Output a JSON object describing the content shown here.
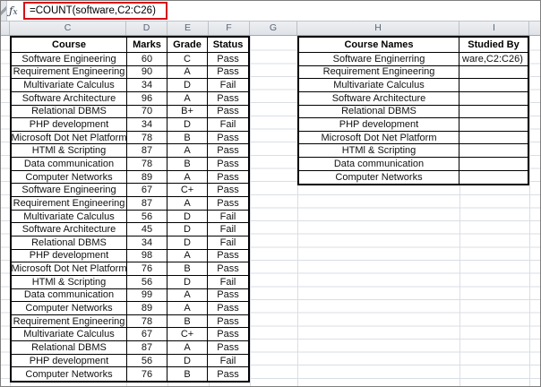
{
  "formula_bar": {
    "fx_label": "fx",
    "formula": "=COUNT(software,C2:C26)"
  },
  "column_headers": [
    "C",
    "D",
    "E",
    "F",
    "G",
    "H",
    "I"
  ],
  "left_table": {
    "headers": [
      "Course",
      "Marks",
      "Grade",
      "Status"
    ],
    "rows": [
      [
        "Software Engineering",
        "60",
        "C",
        "Pass"
      ],
      [
        "Requirement Engineering",
        "90",
        "A",
        "Pass"
      ],
      [
        "Multivariate Calculus",
        "34",
        "D",
        "Fail"
      ],
      [
        "Software Architecture",
        "96",
        "A",
        "Pass"
      ],
      [
        "Relational DBMS",
        "70",
        "B+",
        "Pass"
      ],
      [
        "PHP development",
        "34",
        "D",
        "Fail"
      ],
      [
        "Microsoft Dot Net Platform",
        "78",
        "B",
        "Pass"
      ],
      [
        "HTMl & Scripting",
        "87",
        "A",
        "Pass"
      ],
      [
        "Data communication",
        "78",
        "B",
        "Pass"
      ],
      [
        "Computer Networks",
        "89",
        "A",
        "Pass"
      ],
      [
        "Software Engineering",
        "67",
        "C+",
        "Pass"
      ],
      [
        "Requirement Engineering",
        "87",
        "A",
        "Pass"
      ],
      [
        "Multivariate Calculus",
        "56",
        "D",
        "Fail"
      ],
      [
        "Software Architecture",
        "45",
        "D",
        "Fail"
      ],
      [
        "Relational DBMS",
        "34",
        "D",
        "Fail"
      ],
      [
        "PHP development",
        "98",
        "A",
        "Pass"
      ],
      [
        "Microsoft Dot Net Platform",
        "76",
        "B",
        "Pass"
      ],
      [
        "HTMl & Scripting",
        "56",
        "D",
        "Fail"
      ],
      [
        "Data communication",
        "99",
        "A",
        "Pass"
      ],
      [
        "Computer Networks",
        "89",
        "A",
        "Pass"
      ],
      [
        "Requirement Engineering",
        "78",
        "B",
        "Pass"
      ],
      [
        "Multivariate Calculus",
        "67",
        "C+",
        "Pass"
      ],
      [
        "Relational DBMS",
        "87",
        "A",
        "Pass"
      ],
      [
        "PHP development",
        "56",
        "D",
        "Fail"
      ],
      [
        "Computer Networks",
        "76",
        "B",
        "Pass"
      ]
    ]
  },
  "right_table": {
    "headers": [
      "Course Names",
      "Studied By"
    ],
    "rows": [
      [
        "Software Enginerring",
        "ware,C2:C26)"
      ],
      [
        "Requirement Engineering",
        ""
      ],
      [
        "Multivariate Calculus",
        ""
      ],
      [
        "Software Architecture",
        ""
      ],
      [
        "Relational DBMS",
        ""
      ],
      [
        "PHP development",
        ""
      ],
      [
        "Microsoft Dot Net Platform",
        ""
      ],
      [
        "HTMl & Scripting",
        ""
      ],
      [
        "Data communication",
        ""
      ],
      [
        "Computer Networks",
        ""
      ]
    ]
  },
  "colors": {
    "formula_highlight": "#d51116",
    "table_border": "#000000",
    "gridline": "#d9dee5",
    "header_bg": "#e8ebee",
    "header_text": "#5a6678"
  }
}
